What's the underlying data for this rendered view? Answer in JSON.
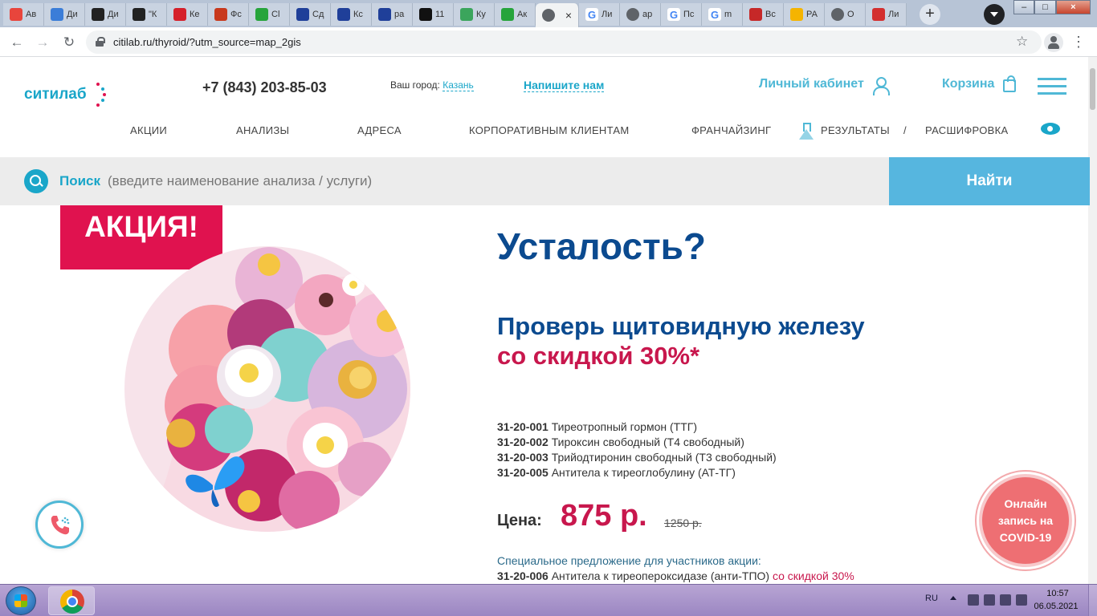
{
  "browser": {
    "tabs": [
      {
        "label": "Ав",
        "icon": "multicolor-dots",
        "color": "#e8453c"
      },
      {
        "label": "Ди",
        "icon": "wave",
        "color": "#3b7dd8"
      },
      {
        "label": "Ди",
        "icon": "stripes",
        "color": "#222222"
      },
      {
        "label": "\"К",
        "icon": "stripes",
        "color": "#222222"
      },
      {
        "label": "Ке",
        "icon": "red-circle",
        "color": "#d5202a"
      },
      {
        "label": "Фс",
        "icon": "diamond",
        "color": "#c8391d"
      },
      {
        "label": "Cl",
        "icon": "green-circle",
        "color": "#26a43b"
      },
      {
        "label": "Сд",
        "icon": "eu-flag",
        "color": "#1f3f99"
      },
      {
        "label": "Кс",
        "icon": "eu-flag",
        "color": "#1f3f99"
      },
      {
        "label": "ра",
        "icon": "eu-flag",
        "color": "#1f3f99"
      },
      {
        "label": "11",
        "icon": "mo-badge",
        "color": "#111111"
      },
      {
        "label": "Ку",
        "icon": "green-leaf",
        "color": "#3ba55c"
      },
      {
        "label": "Ак",
        "icon": "green-circle",
        "color": "#26a43b"
      },
      {
        "label": "",
        "icon": "globe",
        "color": "#5f6368",
        "active": true
      },
      {
        "label": "Ли",
        "icon": "google-g",
        "color": "#4285f4"
      },
      {
        "label": "ар",
        "icon": "globe",
        "color": "#5f6368"
      },
      {
        "label": "Пс",
        "icon": "google-g",
        "color": "#4285f4"
      },
      {
        "label": "m",
        "icon": "google-g",
        "color": "#4285f4"
      },
      {
        "label": "Вс",
        "icon": "red-apple",
        "color": "#c62828"
      },
      {
        "label": "РА",
        "icon": "yellow-bookmark",
        "color": "#f5b400"
      },
      {
        "label": "О",
        "icon": "globe",
        "color": "#5f6368"
      },
      {
        "label": "Ли",
        "icon": "red-shield",
        "color": "#d32f2f"
      }
    ],
    "tab_close": "×",
    "new_tab": "+",
    "window_controls": {
      "minimize": "–",
      "maximize": "□",
      "close": "×"
    },
    "back": "←",
    "forward": "→",
    "reload": "↻",
    "url": "citilab.ru/thyroid/?utm_source=map_2gis",
    "bookmark": "☆",
    "menu": "⋮"
  },
  "header": {
    "logo_text": "ситилаб",
    "phone": "+7 (843) 203-85-03",
    "city_label": "Ваш город:",
    "city": "Казань",
    "write_us": "Напишите нам",
    "cabinet": "Личный кабинет",
    "cart": "Корзина",
    "accent": "#1aa6c9"
  },
  "nav": {
    "promos": "АКЦИИ",
    "analyses": "АНАЛИЗЫ",
    "addresses": "АДРЕСА",
    "corporate": "КОРПОРАТИВНЫМ КЛИЕНТАМ",
    "franchise": "ФРАНЧАЙЗИНГ",
    "results": "РЕЗУЛЬТАТЫ",
    "separator": "/",
    "decoding": "РАСШИФРОВКА"
  },
  "search": {
    "label": "Поиск",
    "placeholder": "(введите наименование анализа / услуги)",
    "button": "Найти"
  },
  "promo": {
    "badge": "АКЦИЯ!",
    "headline": "Усталость?",
    "sub1": "Проверь щитовидную железу",
    "sub2": "со скидкой 30%*",
    "tests": [
      {
        "code": "31-20-001",
        "name": "Тиреотропный гормон (ТТГ)"
      },
      {
        "code": "31-20-002",
        "name": "Тироксин свободный (Т4 свободный)"
      },
      {
        "code": "31-20-003",
        "name": "Трийодтиронин свободный (Т3 свободный)"
      },
      {
        "code": "31-20-005",
        "name": "Антитела к тиреоглобулину (АТ-ТГ)"
      }
    ],
    "price_label": "Цена:",
    "price_new": "875 р.",
    "price_old": "1250 р.",
    "special_note": "Специальное предложение для участников акции:",
    "special_code": "31-20-006",
    "special_name": "Антитела к тиреопероксидазе (анти-ТПО)",
    "special_discount": "со скидкой 30%",
    "brand_red": "#e0124f",
    "brand_blue": "#0b4a8f"
  },
  "widgets": {
    "covid_line1": "Онлайн",
    "covid_line2": "запись на",
    "covid_line3": "COVID-19"
  },
  "taskbar": {
    "lang": "RU",
    "time": "10:57",
    "date": "06.05.2021"
  }
}
